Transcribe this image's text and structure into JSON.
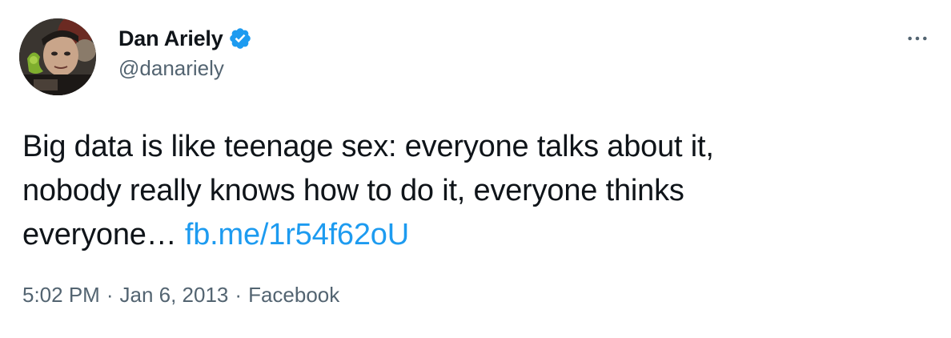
{
  "author": {
    "display_name": "Dan Ariely",
    "handle": "@danariely",
    "verified": true,
    "avatar_icon": "avatar-photo"
  },
  "tweet": {
    "text_lines": [
      "Big data is like teenage sex: everyone talks about it,",
      "nobody really knows how to do it, everyone thinks",
      "everyone… "
    ],
    "link_text": "fb.me/1r54f62oU",
    "time": "5:02 PM",
    "separator": "·",
    "date": "Jan 6, 2013",
    "source": "Facebook"
  },
  "icons": {
    "verified": "verified-badge-icon",
    "more": "more-options-icon"
  },
  "colors": {
    "link": "#1d9bf0",
    "verified": "#1d9bf0",
    "secondary_text": "#536471",
    "primary_text": "#0f1419"
  }
}
